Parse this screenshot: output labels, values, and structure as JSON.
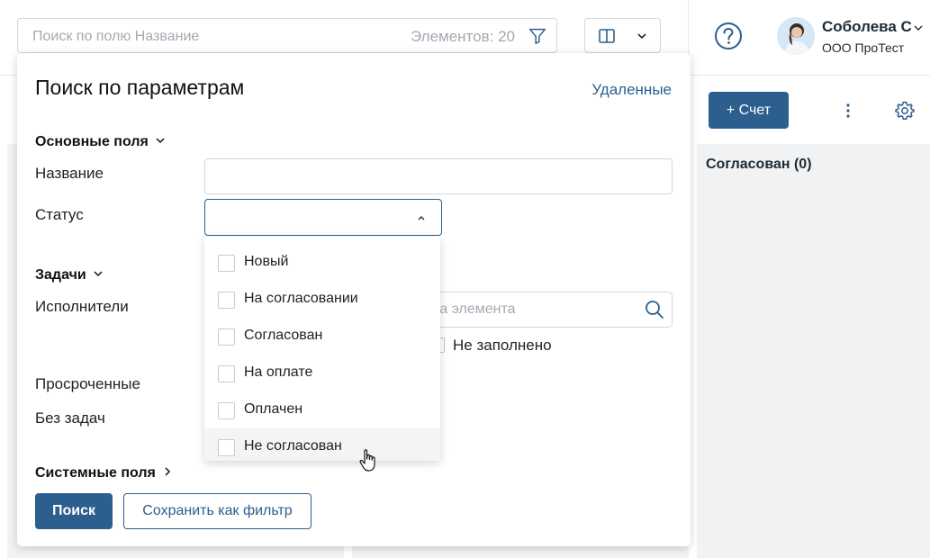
{
  "topbar": {
    "search_placeholder": "Поиск по полю Название",
    "elements_count": "Элементов: 20",
    "user_name": "Соболева С",
    "user_org": "ООО ПроТест"
  },
  "board": {
    "add_button": "+ Счет",
    "columns": [
      {
        "title": ""
      },
      {
        "title": ""
      },
      {
        "title": "Согласован (0)"
      }
    ]
  },
  "panel": {
    "title": "Поиск по параметрам",
    "deleted_link": "Удаленные",
    "sections": {
      "main": "Основные поля",
      "tasks": "Задачи",
      "system": "Системные поля"
    },
    "fields": {
      "name": "Название",
      "status": "Статус",
      "executors": "Исполнители",
      "overdue": "Просроченные",
      "no_tasks": "Без задач"
    },
    "executors_placeholder": "ска элемента",
    "not_filled": "Не заполнено",
    "search_button": "Поиск",
    "save_button": "Сохранить как фильтр"
  },
  "status_options": [
    "Новый",
    "На согласовании",
    "Согласован",
    "На оплате",
    "Оплачен",
    "Не согласован"
  ],
  "colors": {
    "accent": "#2c5f8e",
    "column_bg": "#f1f2f4",
    "placeholder": "#a3aab2"
  }
}
